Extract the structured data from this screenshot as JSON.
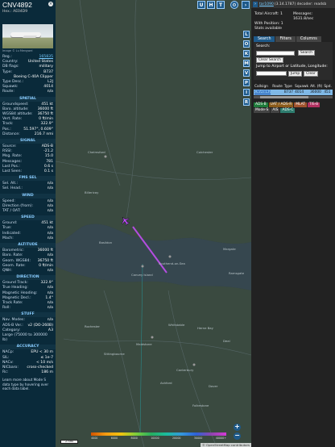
{
  "aircraft": {
    "callsign": "CNV4892",
    "hex_line": "Hex.: AE04D9",
    "photo_credit": "Image © Lu Mengwei",
    "fields": [
      {
        "k": "Reg.:",
        "v": "165835",
        "link": true
      },
      {
        "k": "Country:",
        "v": "United States"
      },
      {
        "k": "DB flags:",
        "v": "military"
      },
      {
        "k": "Type:",
        "v": "B737"
      },
      {
        "k": "",
        "v": "Boeing C-40A Clipper"
      },
      {
        "k": "Type Desc.:",
        "v": "L2J"
      },
      {
        "k": "Squawk:",
        "v": "4014"
      },
      {
        "k": "Route:",
        "v": "n/a"
      }
    ]
  },
  "sections": [
    {
      "title": "SPATIAL",
      "rows": [
        {
          "k": "Groundspeed:",
          "v": "451 kt"
        },
        {
          "k": "Baro. altitude:",
          "v": "36000 ft"
        },
        {
          "k": "WGS84 altitude:",
          "v": "36750 ft"
        },
        {
          "k": "Vert. Rate:",
          "v": "0 ft/min"
        },
        {
          "k": "Track:",
          "v": "322.9°"
        },
        {
          "k": "Pos.:",
          "v": "51.597°, 0.609°"
        },
        {
          "k": "Distance:",
          "v": "216.7 nmi"
        }
      ]
    },
    {
      "title": "SIGNAL",
      "rows": [
        {
          "k": "Source:",
          "v": "ADS-B"
        },
        {
          "k": "RSSI:",
          "v": "-21.2"
        },
        {
          "k": "Msg. Rate:",
          "v": "15.0"
        },
        {
          "k": "Messages:",
          "v": "781"
        },
        {
          "k": "Last Pos.:",
          "v": "0.6 s"
        },
        {
          "k": "Last Seen:",
          "v": "0.1 s"
        }
      ]
    },
    {
      "title": "FMS SEL",
      "rows": [
        {
          "k": "Sel. Alt.:",
          "v": "n/a"
        },
        {
          "k": "Sel. Head.:",
          "v": "n/a"
        }
      ]
    },
    {
      "title": "WIND",
      "rows": [
        {
          "k": "Speed:",
          "v": "n/a"
        },
        {
          "k": "Direction (from):",
          "v": "n/a"
        },
        {
          "k": "TAT / OAT:",
          "v": "n/a"
        }
      ]
    },
    {
      "title": "SPEED",
      "rows": [
        {
          "k": "Ground:",
          "v": "451 kt"
        },
        {
          "k": "True:",
          "v": "n/a"
        },
        {
          "k": "Indicated:",
          "v": "n/a"
        },
        {
          "k": "Mach:",
          "v": "n/a"
        }
      ]
    },
    {
      "title": "ALTITUDE",
      "rows": [
        {
          "k": "Barometric:",
          "v": "36000 ft"
        },
        {
          "k": "Baro. Rate:",
          "v": "n/a"
        },
        {
          "k": "Geom. WGS84:",
          "v": "36750 ft"
        },
        {
          "k": "Geom. Rate:",
          "v": "0 ft/min"
        },
        {
          "k": "QNH:",
          "v": "n/a"
        }
      ]
    },
    {
      "title": "DIRECTION",
      "rows": [
        {
          "k": "Ground Track:",
          "v": "322.9°"
        },
        {
          "k": "True Heading:",
          "v": "n/a"
        },
        {
          "k": "Magnetic Heading:",
          "v": "n/a"
        },
        {
          "k": "Magnetic Decl.:",
          "v": "1.4°"
        },
        {
          "k": "Track Rate:",
          "v": "n/a"
        },
        {
          "k": "Roll:",
          "v": "n/a"
        }
      ]
    },
    {
      "title": "STUFF",
      "rows": [
        {
          "k": "Nav. Modes:",
          "v": "n/a"
        },
        {
          "k": "ADS-B Ver.:",
          "v": "v2 (DO-260B)"
        },
        {
          "k": "Category:",
          "v": "A3"
        },
        {
          "k": "Large (75000 to 300000 lb)",
          "v": ""
        }
      ]
    },
    {
      "title": "ACCURACY",
      "rows": [
        {
          "k": "NACp:",
          "v": "EPU < 30 m"
        },
        {
          "k": "SIL:",
          "v": "≤ 1e-7"
        },
        {
          "k": "NACv:",
          "v": "< 10 m/s"
        },
        {
          "k": "NICbaro:",
          "v": "cross-checked"
        },
        {
          "k": "Rc:",
          "v": "186 m"
        }
      ]
    }
  ],
  "footer_text": "Learn more about Mode S data type by hovering over each data label.",
  "map": {
    "top_buttons": [
      "U",
      "H",
      "T"
    ],
    "side_buttons": [
      "L",
      "O",
      "K",
      "M",
      "V",
      "P",
      "I",
      "R"
    ],
    "places": [
      "Chelmsford",
      "Southend-on-Sea",
      "Canvey Island",
      "Maidstone",
      "Canterbury",
      "Margate",
      "Ramsgate",
      "Dover",
      "Folkestone",
      "Ashford",
      "Sittingbourne",
      "Whitstable",
      "Herne Bay",
      "Deal",
      "Rochester",
      "Colchester",
      "Basildon",
      "Billericay"
    ],
    "scale_label": "2 nmi",
    "alt_labels": [
      "4000",
      "6000",
      "8000",
      "10000",
      "20000",
      "30000",
      "40000+"
    ],
    "attribution": "© OpenStreetMap contributors"
  },
  "right": {
    "header_link": "tar1090",
    "header_text": "(3.14.1787) decoder: readsb",
    "stats": [
      {
        "k": "Total Aircraft: 1",
        "v": "Messages: 1631.8/sec"
      },
      {
        "k": "With Position: 1",
        "v": ""
      },
      {
        "k": "Stats available",
        "v": ""
      }
    ],
    "tabs": [
      "Search",
      "Filters",
      "Columns"
    ],
    "search_label": "Search:",
    "search_button": "Search",
    "clear_button": "Clear Search",
    "jump_label": "Jump to Airport or Latitude, Longitude:",
    "jump_button": "Jump",
    "clear2_button": "Clear",
    "table_headers": [
      "Callsign",
      "Route",
      "Type",
      "Squawk",
      "Alt. (ft)",
      "Spd."
    ],
    "table_row": [
      "CNV4892",
      "",
      "B737",
      "4014",
      "36000",
      "451"
    ],
    "legend": [
      {
        "label": "ADS-B",
        "color": "#1e7a3a"
      },
      {
        "label": "UAT / ADS-R",
        "color": "#8a5a1a"
      },
      {
        "label": "MLAT",
        "color": "#a0522d"
      },
      {
        "label": "TIS-B",
        "color": "#b03060"
      },
      {
        "label": "Mode-S",
        "color": "#444"
      },
      {
        "label": "AIS",
        "color": "#444"
      },
      {
        "label": "ADS-C",
        "color": "#2e7d6f"
      }
    ]
  }
}
